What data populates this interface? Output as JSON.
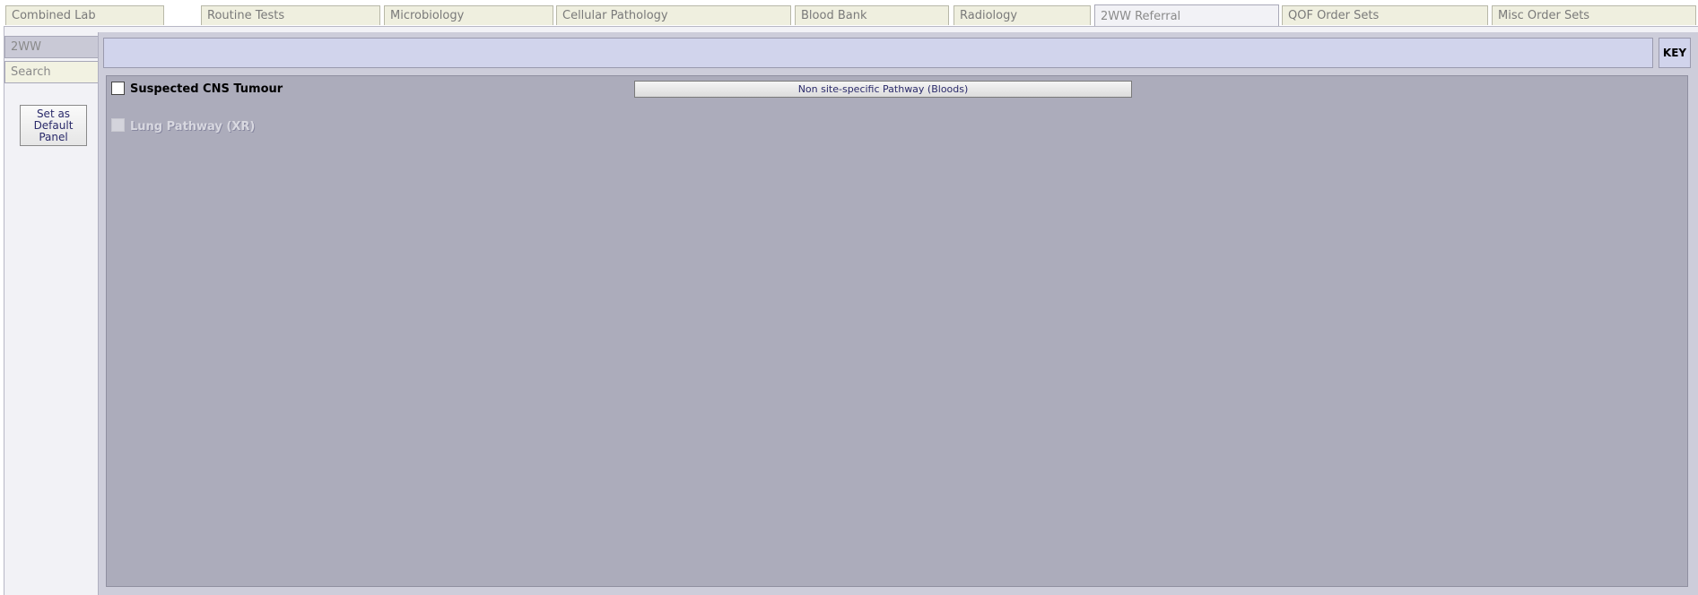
{
  "tabs": [
    {
      "label": "Combined Lab",
      "active": false
    },
    {
      "label": "Routine Tests",
      "active": false
    },
    {
      "label": "Microbiology",
      "active": false
    },
    {
      "label": "Cellular Pathology",
      "active": false
    },
    {
      "label": "Blood Bank",
      "active": false
    },
    {
      "label": "Radiology",
      "active": false
    },
    {
      "label": "2WW Referral",
      "active": true
    },
    {
      "label": "QOF Order Sets",
      "active": false
    },
    {
      "label": "Misc Order Sets",
      "active": false
    }
  ],
  "sidebar": {
    "panel_name": "2WW",
    "search_placeholder": "Search",
    "default_button": "Set as Default Panel"
  },
  "header": {
    "key_label": "KEY"
  },
  "content": {
    "items": [
      {
        "label": "Suspected CNS Tumour",
        "checked": false,
        "enabled": true
      },
      {
        "label": "Lung Pathway (XR)",
        "checked": false,
        "enabled": false
      }
    ],
    "pathway_button": "Non site-specific Pathway (Bloods)"
  },
  "colors": {
    "tab_bg": "#efefdf",
    "active_tab_bg": "#f2f2f6",
    "header_bg": "#d1d4ec",
    "content_bg": "#acacbb",
    "button_text": "#2a2a6a"
  }
}
